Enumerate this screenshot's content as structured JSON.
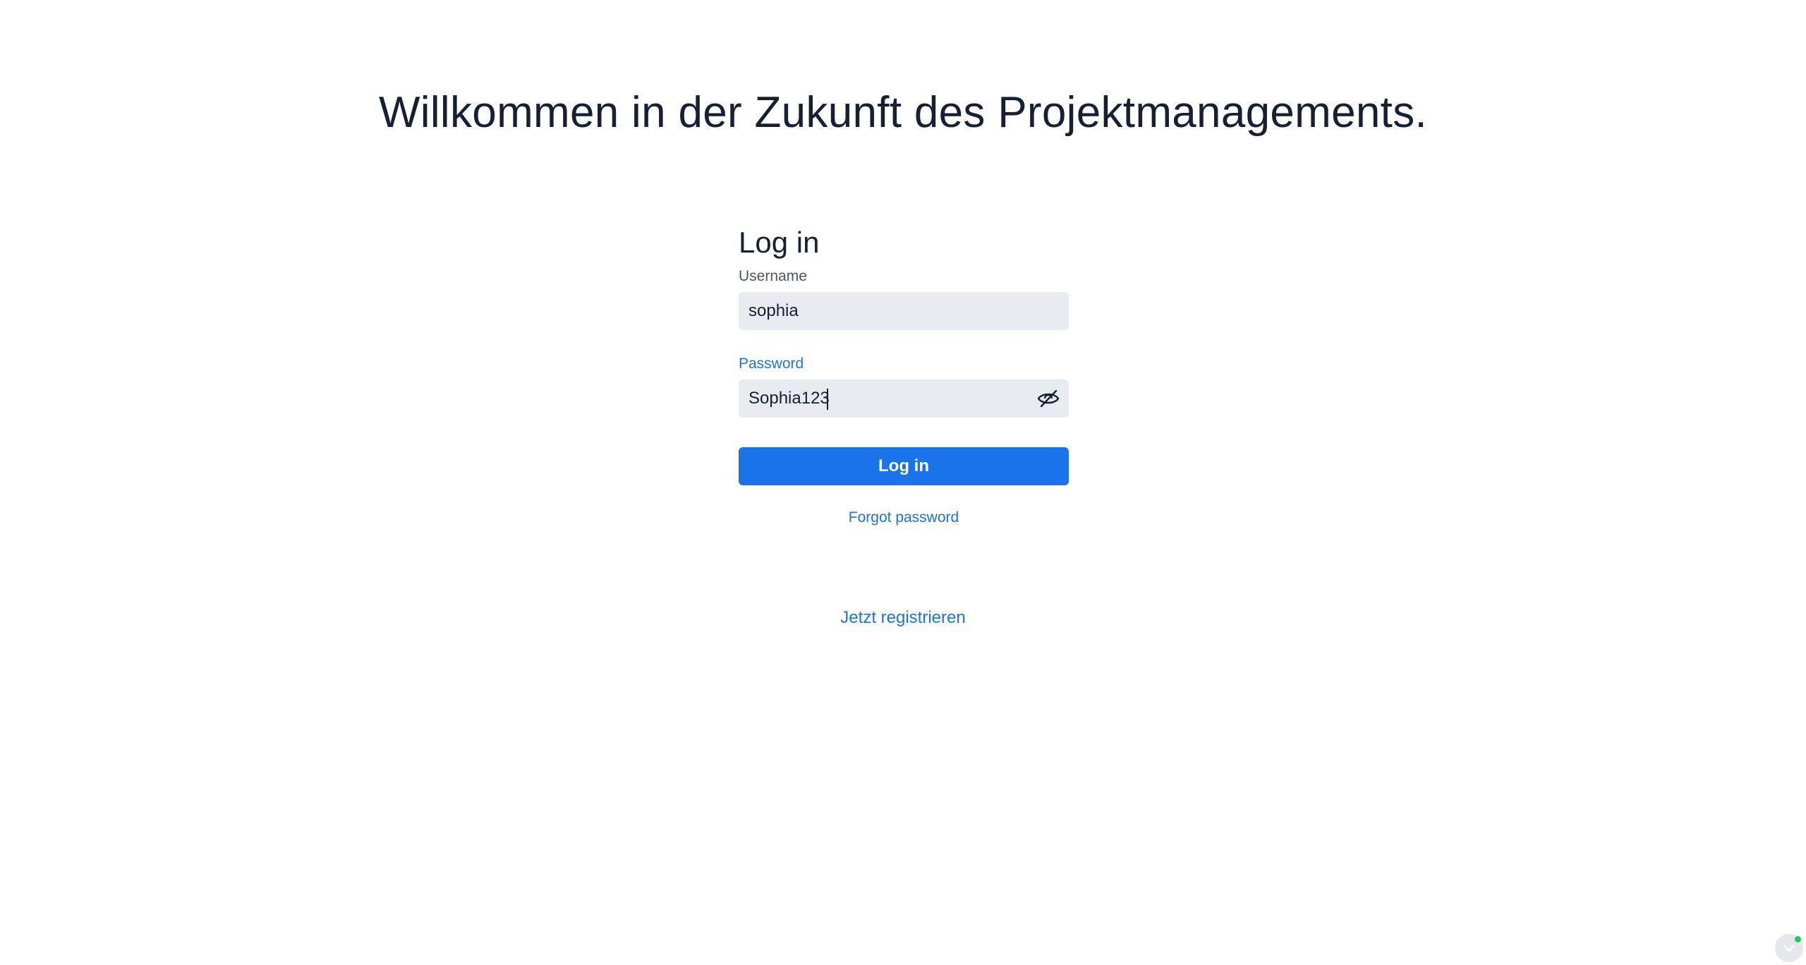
{
  "welcome": {
    "headline": "Willkommen in der Zukunft des Projektmanagements."
  },
  "login": {
    "title": "Log in",
    "username_label": "Username",
    "username_value": "sophia",
    "password_label": "Password",
    "password_value": "Sophia123",
    "submit_label": "Log in",
    "forgot_label": "Forgot password"
  },
  "register": {
    "link_label": "Jetzt registrieren"
  },
  "colors": {
    "accent": "#1a73e8",
    "text": "#172033",
    "input_bg": "#e8ebef",
    "status_dot": "#22c55e"
  },
  "icons": {
    "password_toggle": "eye-slash-icon",
    "bottom_badge": "chevron-down-circle-icon"
  }
}
